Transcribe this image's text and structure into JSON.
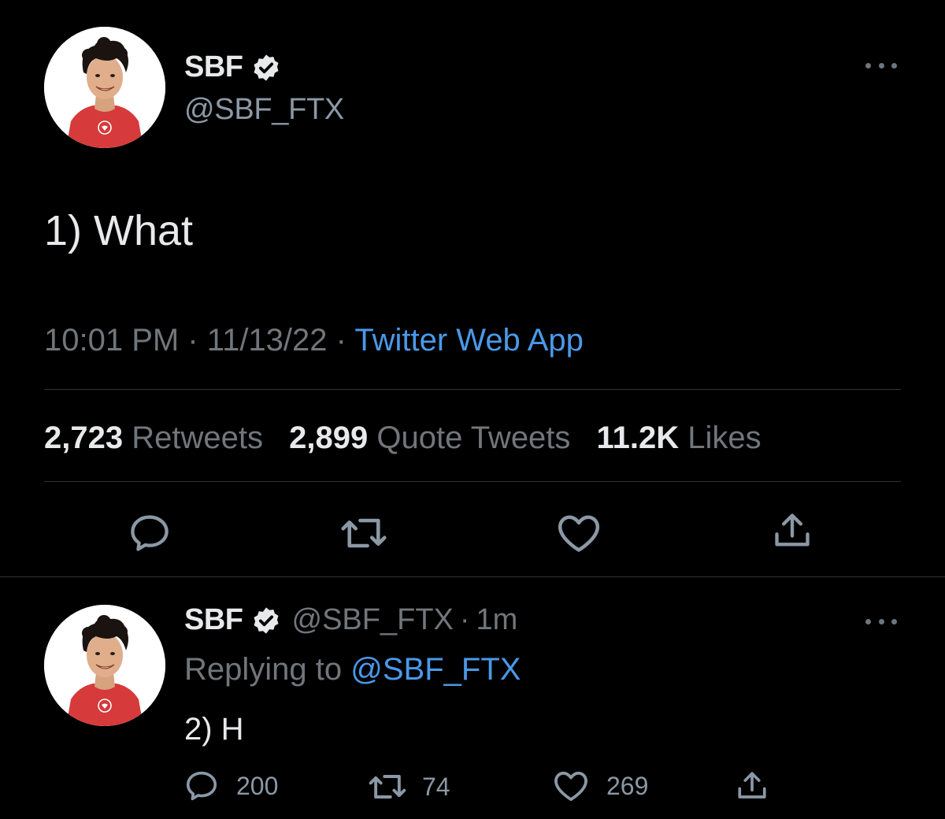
{
  "main_tweet": {
    "display_name": "SBF",
    "handle": "@SBF_FTX",
    "text": "1) What",
    "time": "10:01 PM",
    "separator": "·",
    "date": "11/13/22",
    "source": "Twitter Web App",
    "stats": {
      "retweets_count": "2,723",
      "retweets_label": "Retweets",
      "quotes_count": "2,899",
      "quotes_label": "Quote Tweets",
      "likes_count": "11.2K",
      "likes_label": "Likes"
    },
    "actions": [
      "reply-icon",
      "retweet-icon",
      "like-icon",
      "share-icon"
    ]
  },
  "reply_tweet": {
    "display_name": "SBF",
    "handle": "@SBF_FTX",
    "separator": "·",
    "age": "1m",
    "replying_to_label": "Replying to",
    "replying_to_handle": "@SBF_FTX",
    "text": "2) H",
    "reply_count": "200",
    "retweet_count": "74",
    "like_count": "269"
  },
  "colors": {
    "background": "#000000",
    "text_primary": "#e7e9ea",
    "text_secondary": "#71767b",
    "link": "#4a99e9",
    "divider": "#2f3336",
    "avatar_shirt": "#d63a3a"
  }
}
